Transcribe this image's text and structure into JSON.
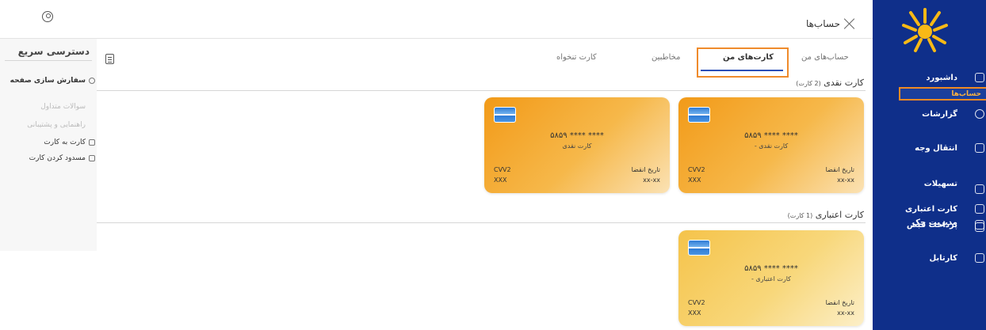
{
  "header": {
    "title": "حساب‌ها"
  },
  "sidebar": {
    "items": [
      {
        "label": "داشبورد"
      },
      {
        "label": "حساب‌ها"
      },
      {
        "label": "گزارشات"
      },
      {
        "label": "انتقال وجه"
      },
      {
        "label": "تسهیلات"
      },
      {
        "label": "کارت اعتباری"
      },
      {
        "label": "مدیریت چک"
      },
      {
        "label": "پرداخت قبض"
      },
      {
        "label": "کارتابل"
      }
    ]
  },
  "tabs": [
    {
      "label": "حساب‌های من"
    },
    {
      "label": "کارت‌های من"
    },
    {
      "label": "مخاطبین"
    },
    {
      "label": "کارت تنخواه"
    }
  ],
  "quick_access": {
    "title": "دسترسی سریع",
    "customize": "سفارش سازی صفحه",
    "items": [
      {
        "label": "سوالات متداول"
      },
      {
        "label": "راهنمایی و پشتیبانی"
      },
      {
        "label": "کارت به کارت"
      },
      {
        "label": "مسدود کردن کارت"
      }
    ]
  },
  "sections": {
    "cash": {
      "title": "کارت نقدی",
      "count": "(2 کارت)"
    },
    "credit": {
      "title": "کارت اعتباری",
      "count": "(1 کارت)"
    }
  },
  "cards": [
    {
      "number": "۵۸۵۹ **** ****",
      "type": "- کارت نقدی",
      "cvv_label": "CVV2",
      "cvv": "XXX",
      "exp_label": "تاریخ انقضا",
      "exp": "xx-xx"
    },
    {
      "number": "۵۸۵۹ **** ****",
      "type": "کارت نقدی",
      "cvv_label": "CVV2",
      "cvv": "XXX",
      "exp_label": "تاریخ انقضا",
      "exp": "xx-xx"
    },
    {
      "number": "۵۸۵۹ **** ****",
      "type": "- کارت اعتباری",
      "cvv_label": "CVV2",
      "cvv": "XXX",
      "exp_label": "تاریخ انقضا",
      "exp": "xx-xx"
    }
  ],
  "colors": {
    "sidebar": "#0f2f8a",
    "accent": "#ef8b2c",
    "tab_underline": "#2b4fb8"
  }
}
